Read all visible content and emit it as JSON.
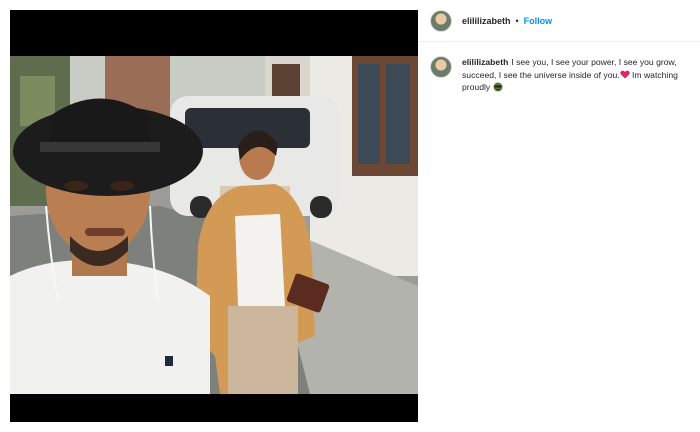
{
  "post": {
    "username": "elililizabeth",
    "separator": "•",
    "follow_label": "Follow"
  },
  "caption": {
    "username": "elililizabeth",
    "text_before_heart": "I see you, I see your power, I see you grow, succeed, I see the universe inside of you.",
    "text_after_heart": " Im watching proudly ",
    "emojis": [
      "red-heart-icon",
      "sunglasses-face-icon"
    ]
  },
  "colors": {
    "follow": "#0095f6",
    "text": "#262626",
    "media_background": "#000000"
  }
}
